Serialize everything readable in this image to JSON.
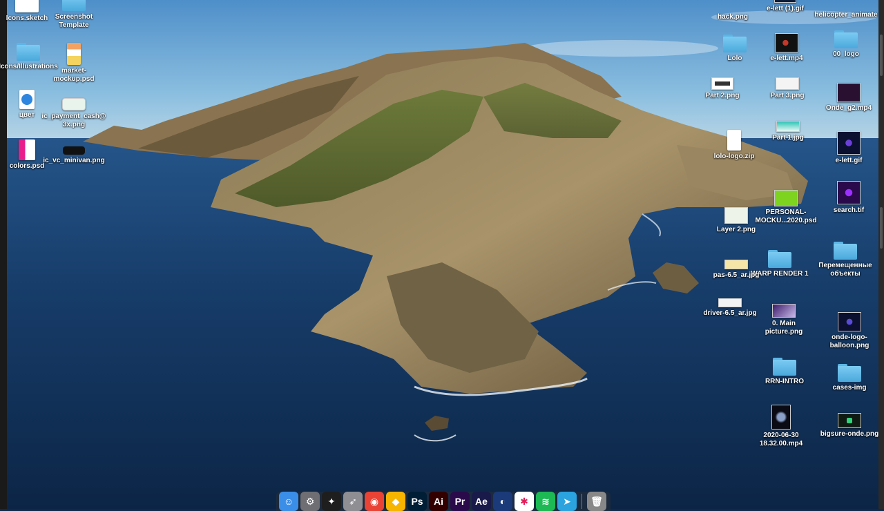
{
  "desktop": {
    "items": [
      {
        "name": "Icons.sketch",
        "label": "Icons.sketch"
      },
      {
        "name": "screenshot-template",
        "label": "Screenshot\nTemplate"
      },
      {
        "name": "illustrations-folder",
        "label": "Icons/Illustrations"
      },
      {
        "name": "market-mockup",
        "label": "market-\nmockup.psd"
      },
      {
        "name": "tsvet-webloc",
        "label": "цвет"
      },
      {
        "name": "ic-payment-cash",
        "label": "ic_payment_cash@\n3x.png"
      },
      {
        "name": "colors-psd",
        "label": "colors.psd"
      },
      {
        "name": "ic-vc-minivan",
        "label": "ic_vc_minivan.png"
      },
      {
        "name": "hack-png",
        "label": "hack.png"
      },
      {
        "name": "e-lett-1-gif",
        "label": "e-lett (1).gif"
      },
      {
        "name": "helicopter-animate",
        "label": "helicopter_animate"
      },
      {
        "name": "lolo-folder",
        "label": "Lolo"
      },
      {
        "name": "e-lett-mp4",
        "label": "e-lett.mp4"
      },
      {
        "name": "00-logo-folder",
        "label": "00_logo"
      },
      {
        "name": "part-2",
        "label": "Part 2.png"
      },
      {
        "name": "part-3",
        "label": "Part 3.png"
      },
      {
        "name": "onde-g2",
        "label": "Onde_g2.mp4"
      },
      {
        "name": "part-1",
        "label": "Part 1.jpg"
      },
      {
        "name": "lolo-logo-zip",
        "label": "lolo-logo.zip"
      },
      {
        "name": "e-lett-gif",
        "label": "e-lett.gif"
      },
      {
        "name": "personal-mockup",
        "label": "PERSONAL-\nMOCKU...2020.psd"
      },
      {
        "name": "search-tif",
        "label": "search.tif"
      },
      {
        "name": "layer-2",
        "label": "Layer 2.png"
      },
      {
        "name": "warp-render-folder",
        "label": "WARP RENDER 1"
      },
      {
        "name": "pas-65",
        "label": "pas-6.5_ar.jpg"
      },
      {
        "name": "moved-objects-folder",
        "label": "Перемещенные\nобъекты"
      },
      {
        "name": "driver-65",
        "label": "driver-6.5_ar.jpg"
      },
      {
        "name": "main-picture",
        "label": "0. Main\npicture.png"
      },
      {
        "name": "onde-logo-balloon",
        "label": "onde-logo-\nballoon.png"
      },
      {
        "name": "rrn-intro-folder",
        "label": "RRN-INTRO"
      },
      {
        "name": "cases-img-folder",
        "label": "cases-img"
      },
      {
        "name": "screen-recording",
        "label": "2020-06-30\n18.32.00.mp4"
      },
      {
        "name": "bigsure-onde",
        "label": "bigsure-onde.png"
      }
    ]
  },
  "dock": {
    "apps": [
      {
        "name": "finder",
        "glyph": "☺",
        "color": "#3b8ee8"
      },
      {
        "name": "system-preferences",
        "glyph": "⚙",
        "color": "#6e6e73"
      },
      {
        "name": "figma",
        "glyph": "✦",
        "color": "#1e1e1e"
      },
      {
        "name": "launchpad",
        "glyph": "➶",
        "color": "#8e8e93"
      },
      {
        "name": "chrome",
        "glyph": "◉",
        "color": "#e84335"
      },
      {
        "name": "sketch",
        "glyph": "◆",
        "color": "#f7b500"
      },
      {
        "name": "photoshop",
        "glyph": "Ps",
        "color": "#001e36"
      },
      {
        "name": "illustrator",
        "glyph": "Ai",
        "color": "#330000"
      },
      {
        "name": "premiere",
        "glyph": "Pr",
        "color": "#2a0a4a"
      },
      {
        "name": "after-effects",
        "glyph": "Ae",
        "color": "#1a1a4a"
      },
      {
        "name": "cinema-4d",
        "glyph": "◐",
        "color": "#1b3a7a"
      },
      {
        "name": "slack",
        "glyph": "✱",
        "color": "#ffffff"
      },
      {
        "name": "spotify",
        "glyph": "≋",
        "color": "#1db954"
      },
      {
        "name": "telegram",
        "glyph": "➤",
        "color": "#2aa3df"
      },
      {
        "name": "trash",
        "glyph": "🗑",
        "color": "#888888"
      }
    ]
  }
}
